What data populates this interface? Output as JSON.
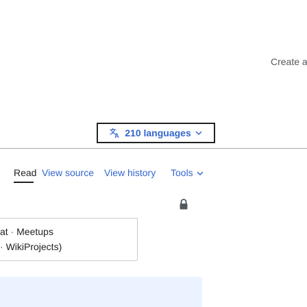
{
  "header": {
    "create_account_label": "Create a"
  },
  "language_button": {
    "label": "210 languages",
    "icon": "translate-icon",
    "chevron": "chevron-down-icon"
  },
  "tabs": [
    {
      "label": "Read",
      "active": true
    },
    {
      "label": "View source",
      "active": false
    },
    {
      "label": "View history",
      "active": false
    },
    {
      "label": "Tools",
      "active": false,
      "has_dropdown": true
    }
  ],
  "protection_icon": "lock-icon",
  "sidebar": {
    "lines": [
      {
        "prefix": "at",
        "separator": " · ",
        "text": "Meetups"
      },
      {
        "prefix": "",
        "separator": "· ",
        "text": "WikiProjects)"
      }
    ]
  },
  "colors": {
    "link": "#3366cc",
    "text": "#202122",
    "border": "#a2a9b1",
    "banner": "#eaf3ff"
  }
}
